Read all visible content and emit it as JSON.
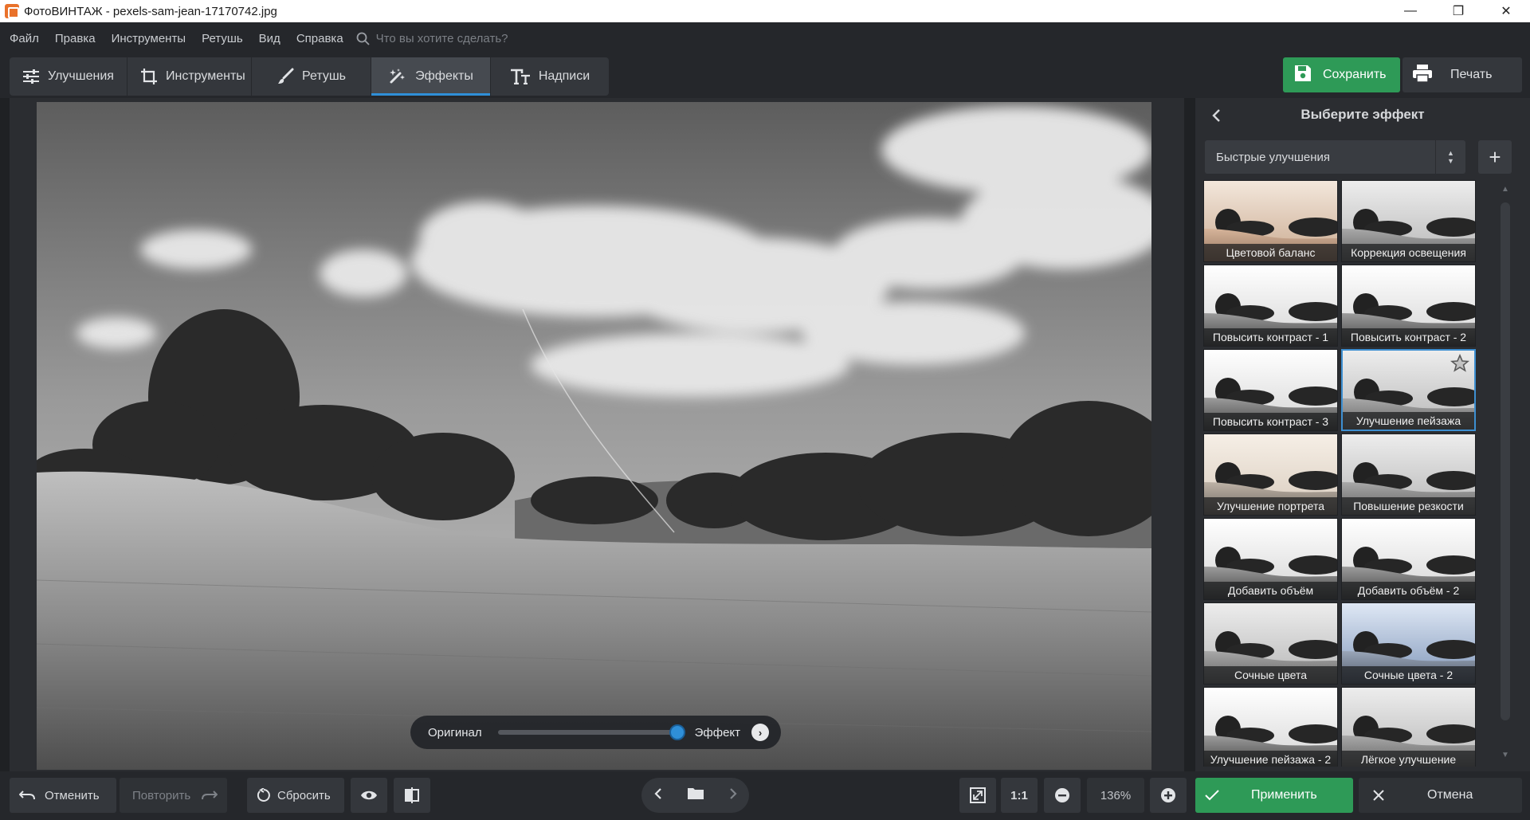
{
  "window": {
    "title": "ФотоВИНТАЖ - pexels-sam-jean-17170742.jpg",
    "controls": {
      "minimize": "—",
      "maximize": "❐",
      "close": "✕"
    }
  },
  "menu": {
    "items": [
      "Файл",
      "Правка",
      "Инструменты",
      "Ретушь",
      "Вид",
      "Справка"
    ],
    "search_placeholder": "Что вы хотите сделать?"
  },
  "toolbar": {
    "tabs": [
      {
        "label": "Улучшения",
        "icon": "sliders-icon"
      },
      {
        "label": "Инструменты",
        "icon": "crop-icon"
      },
      {
        "label": "Ретушь",
        "icon": "brush-icon"
      },
      {
        "label": "Эффекты",
        "icon": "magic-wand-icon",
        "active": true
      },
      {
        "label": "Надписи",
        "icon": "text-icon"
      }
    ],
    "save_label": "Сохранить",
    "print_label": "Печать"
  },
  "compare": {
    "left_label": "Оригинал",
    "right_label": "Эффект",
    "position": 1.0
  },
  "panel": {
    "title": "Выберите эффект",
    "category": "Быстрые улучшения",
    "add_label": "+",
    "effects": [
      {
        "label": "Цветовой баланс",
        "tone": "warm"
      },
      {
        "label": "Коррекция освещения",
        "tone": "gray"
      },
      {
        "label": "Повысить контраст - 1",
        "tone": "contrast"
      },
      {
        "label": "Повысить контраст - 2",
        "tone": "contrast"
      },
      {
        "label": "Повысить контраст - 3",
        "tone": "contrast"
      },
      {
        "label": "Улучшение пейзажа",
        "tone": "gray",
        "selected": true,
        "favorite": true
      },
      {
        "label": "Улучшение портрета",
        "tone": "warmlight"
      },
      {
        "label": "Повышение резкости",
        "tone": "gray"
      },
      {
        "label": "Добавить объём",
        "tone": "contrast"
      },
      {
        "label": "Добавить объём - 2",
        "tone": "contrast"
      },
      {
        "label": "Сочные цвета",
        "tone": "gray"
      },
      {
        "label": "Сочные цвета - 2",
        "tone": "cool"
      },
      {
        "label": "Улучшение пейзажа - 2",
        "tone": "contrast"
      },
      {
        "label": "Лёгкое улучшение",
        "tone": "gray"
      }
    ]
  },
  "bottom": {
    "undo_label": "Отменить",
    "redo_label": "Повторить",
    "reset_label": "Сбросить",
    "zoom_one_label": "1:1",
    "zoom_value": "136%",
    "apply_label": "Применить",
    "cancel_label": "Отмена"
  },
  "colors": {
    "accent_green": "#2e9a57",
    "accent_blue": "#2f8fd8",
    "panel_bg": "#2b2d31",
    "bar_bg": "#25272b"
  }
}
